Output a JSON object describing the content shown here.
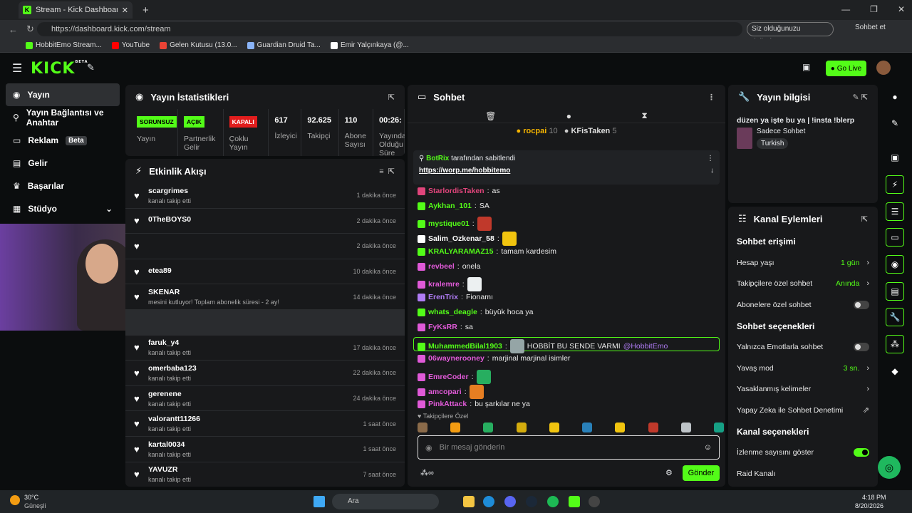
{
  "browser": {
    "tab_title": "Stream - Kick Dashboard",
    "url": "https://dashboard.kick.com/stream",
    "signin_label": "Siz olduğunuzu doğrulayın",
    "chat_label": "Sohbet et",
    "bookmarks": [
      {
        "label": "HobbitEmo Stream...",
        "color": "#53fc18"
      },
      {
        "label": "YouTube",
        "color": "#ff0000"
      },
      {
        "label": "Gelen Kutusu (13.0...",
        "color": "#ea4335"
      },
      {
        "label": "Guardian Druid Ta...",
        "color": "#8ab4f8"
      },
      {
        "label": "Emir Yalçınkaya (@...",
        "color": "#ffffff"
      }
    ]
  },
  "app": {
    "logo": "KICK",
    "logo_sup": "BETA",
    "go_live": "Go Live"
  },
  "sidebar": {
    "items": [
      {
        "label": "Yayın"
      },
      {
        "label": "Yayın Bağlantısı ve Anahtar"
      },
      {
        "label": "Reklam",
        "badge": "Beta"
      },
      {
        "label": "Gelir"
      },
      {
        "label": "Başarılar"
      },
      {
        "label": "Stüdyo"
      }
    ]
  },
  "stats": {
    "title": "Yayın İstatistikleri",
    "cols": [
      {
        "badge": "SORUNSUZ",
        "badge_color": "#53fc18",
        "label": "Yayın"
      },
      {
        "badge": "AÇIK",
        "badge_color": "#53fc18",
        "label": "Partnerlik Gelir"
      },
      {
        "badge": "KAPALI",
        "badge_color": "#e11d1d",
        "label": "Çoklu Yayın"
      },
      {
        "value": "617",
        "label": "İzleyici"
      },
      {
        "value": "92.625",
        "label": "Takipçi"
      },
      {
        "value": "110",
        "label": "Abone Sayısı"
      },
      {
        "value": "00:26:",
        "label": "Yayında Olduğu Süre"
      }
    ]
  },
  "feed": {
    "title": "Etkinlik Akışı",
    "rows": [
      {
        "name": "scargrimes",
        "sub": "kanalı takip etti",
        "time": "1 dakika önce"
      },
      {
        "name": "0TheBOYS0",
        "sub": "",
        "time": "2 dakika önce"
      },
      {
        "name": "",
        "sub": "",
        "time": "2 dakika önce"
      },
      {
        "name": "etea89",
        "sub": "",
        "time": "10 dakika önce"
      },
      {
        "name": "SKENAR",
        "sub": "mesini kutluyor! Toplam abonelik süresi - 2 ay!",
        "time": "14 dakika önce"
      },
      {
        "name": "",
        "sub": "",
        "time": ""
      },
      {
        "name": "faruk_y4",
        "sub": "kanalı takip etti",
        "time": "17 dakika önce"
      },
      {
        "name": "omerbaba123",
        "sub": "kanalı takip etti",
        "time": "22 dakika önce"
      },
      {
        "name": "gerenene",
        "sub": "kanalı takip etti",
        "time": "24 dakika önce"
      },
      {
        "name": "valorantt11266",
        "sub": "kanalı takip etti",
        "time": "1 saat önce"
      },
      {
        "name": "kartal0034",
        "sub": "kanalı takip etti",
        "time": "1 saat önce"
      },
      {
        "name": "YAVUZR",
        "sub": "kanalı takip etti",
        "time": "7 saat önce"
      }
    ]
  },
  "chat": {
    "title": "Sohbet",
    "top": [
      {
        "name": "rocpai",
        "count": "10"
      },
      {
        "name": "KFisTaken",
        "count": "5"
      }
    ],
    "pinned_by": "BotRix",
    "pinned_suffix": "tarafından sabitlendi",
    "pinned_link": "https://worp.me/hobbitemo",
    "messages": [
      {
        "user": "StarlordisTaken",
        "text": "as",
        "color": "#e0457b"
      },
      {
        "user": "Aykhan_101",
        "text": "SA",
        "color": "#53fc18"
      },
      {
        "user": "mystique01",
        "text": "",
        "color": "#53fc18",
        "emote": "#c0392b"
      },
      {
        "user": "Salim_Ozkenar_58",
        "text": "",
        "color": "#ffffff",
        "emote": "#f1c40f"
      },
      {
        "user": "KRALYARAMAZ15",
        "text": "tamam kardesim",
        "color": "#53fc18"
      },
      {
        "user": "revbeel",
        "text": "onela",
        "color": "#e05ad8"
      },
      {
        "user": "kralemre",
        "text": "",
        "color": "#e05ad8",
        "emote": "#ecf0f1"
      },
      {
        "user": "ErenTrix",
        "text": "Fionamı",
        "color": "#b07cf5"
      },
      {
        "user": "whats_deagle",
        "text": "büyük hoca ya",
        "color": "#53fc18"
      },
      {
        "user": "FyKsRR",
        "text": "sa",
        "color": "#e05ad8"
      },
      {
        "user": "MuhammedBilal1903",
        "text": "HOBBİT BU SENDE VARMI",
        "mention": "@HobbitEmo",
        "color": "#53fc18",
        "emote": "#95a5a6"
      },
      {
        "user": "06wayneroonеy",
        "text": "marjinal marjinal isimler",
        "color": "#e05ad8"
      },
      {
        "user": "EmreCoder",
        "text": "",
        "color": "#e05ad8",
        "emote": "#27ae60"
      },
      {
        "user": "amcopari",
        "text": "",
        "color": "#e05ad8",
        "emote": "#e67e22"
      },
      {
        "user": "PinkAttack",
        "text": "bu şarkılar ne ya",
        "color": "#e05ad8"
      }
    ],
    "followers_only": "Takipçilere Özel",
    "placeholder": "Bir mesaj gönderin",
    "send": "Gönder"
  },
  "info": {
    "title": "Yayın bilgisi",
    "stream_title": "düzen ya işte bu ya | !insta !blerp",
    "category": "Sadece Sohbet",
    "language": "Turkish"
  },
  "actions": {
    "title": "Kanal Eylemleri",
    "access_head": "Sohbet erişimi",
    "access_rows": [
      {
        "label": "Hesap yaşı",
        "value": "1 gün"
      },
      {
        "label": "Takipçilere özel sohbet",
        "value": "Anında"
      },
      {
        "label": "Abonelere özel sohbet",
        "value": "",
        "toggle": "off"
      }
    ],
    "options_head": "Sohbet seçenekleri",
    "option_rows": [
      {
        "label": "Yalnızca Emotlarla sohbet",
        "value": "",
        "toggle": "off"
      },
      {
        "label": "Yavaş mod",
        "value": "3 sn."
      },
      {
        "label": "Yasaklanmış kelimeler",
        "value": ""
      },
      {
        "label": "Yapay Zeka ile Sohbet Denetimi",
        "value": ""
      }
    ],
    "channel_head": "Kanal seçenekleri",
    "channel_rows": [
      {
        "label": "İzlenme sayısını göster",
        "toggle": "on"
      },
      {
        "label": "Raid Kanalı"
      }
    ]
  },
  "taskbar": {
    "weather_temp": "30°C",
    "weather_label": "Güneşli",
    "search": "Ara",
    "time": "4:18 PM",
    "date": "8/20/2026"
  }
}
